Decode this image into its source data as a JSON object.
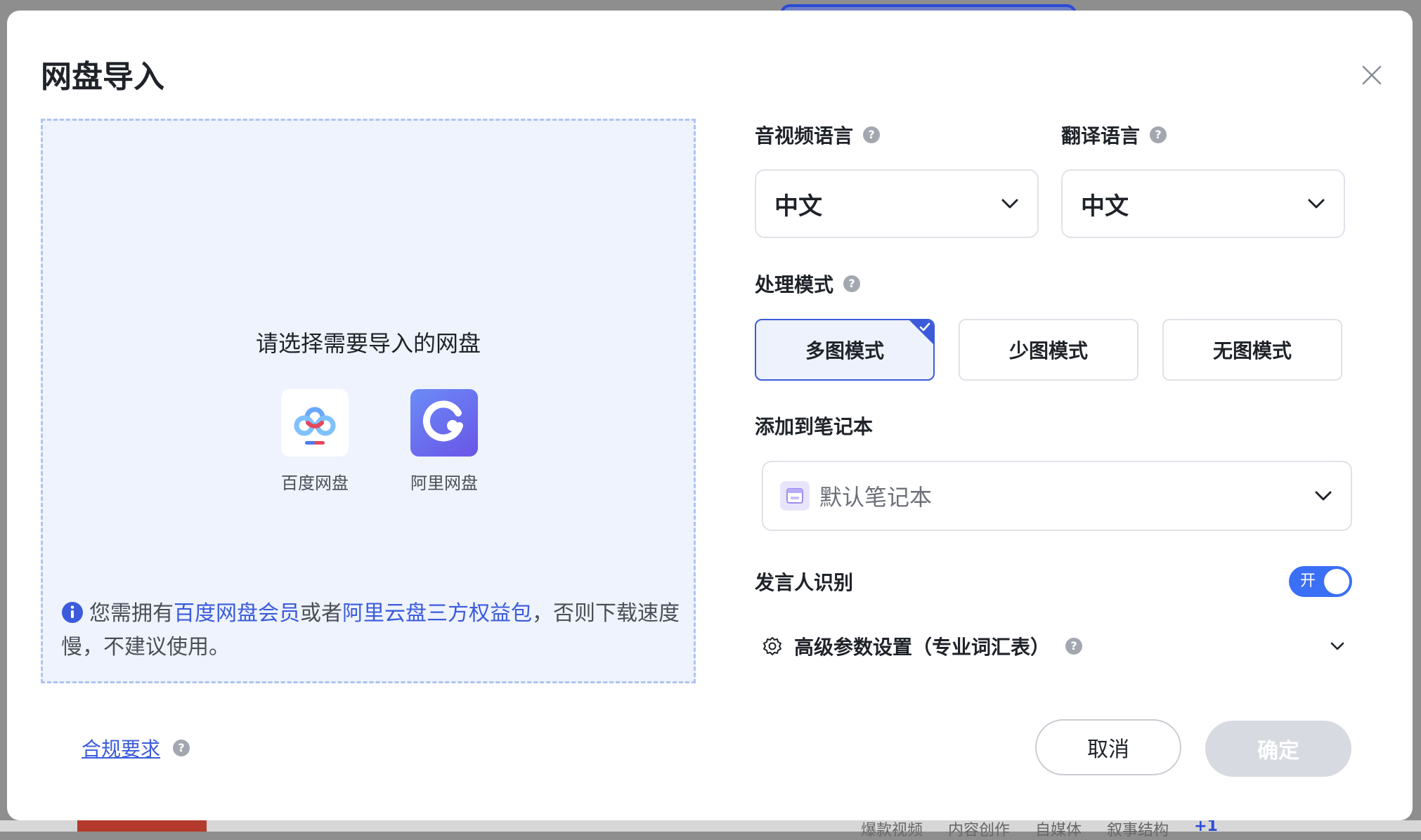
{
  "background": {
    "tags": [
      "爆款视频",
      "内容创作",
      "自媒体",
      "叙事结构"
    ],
    "more_count": "+1"
  },
  "dialog": {
    "title": "网盘导入",
    "close_icon": "close-icon",
    "drop_zone": {
      "prompt": "请选择需要导入的网盘",
      "drives": [
        {
          "label": "百度网盘",
          "icon": "baidu-netdisk-icon"
        },
        {
          "label": "阿里网盘",
          "icon": "aliyun-drive-icon"
        }
      ],
      "notice": {
        "prefix": "您需拥有",
        "link1": "百度网盘会员",
        "middle": "或者",
        "link2": "阿里云盘三方权益包",
        "suffix": "，否则下载速度慢，不建议使用。"
      }
    },
    "compliance_link": "合规要求",
    "audio_language": {
      "label": "音视频语言",
      "value": "中文"
    },
    "translate_language": {
      "label": "翻译语言",
      "value": "中文"
    },
    "processing_mode": {
      "label": "处理模式",
      "options": [
        "多图模式",
        "少图模式",
        "无图模式"
      ],
      "selected": "多图模式"
    },
    "notebook": {
      "label": "添加到笔记本",
      "value": "默认笔记本"
    },
    "speaker_recognition": {
      "label": "发言人识别",
      "toggle_text": "开",
      "enabled": true
    },
    "advanced": {
      "label": "高级参数设置（专业词汇表）"
    },
    "buttons": {
      "cancel": "取消",
      "confirm": "确定"
    }
  },
  "colors": {
    "accent": "#3b5bdb",
    "toggle_on": "#3b6ff5",
    "disabled_button": "#d7dae0",
    "drop_zone_bg": "#eef3fd"
  }
}
